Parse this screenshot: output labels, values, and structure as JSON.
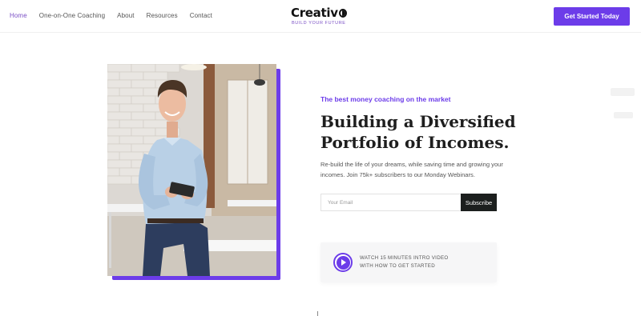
{
  "nav": {
    "items": [
      {
        "label": "Home",
        "active": true
      },
      {
        "label": "One-on-One Coaching",
        "active": false
      },
      {
        "label": "About",
        "active": false
      },
      {
        "label": "Resources",
        "active": false
      },
      {
        "label": "Contact",
        "active": false
      }
    ]
  },
  "logo": {
    "wordmark": "Creativ",
    "tagline": "BUILD YOUR FUTURE"
  },
  "header": {
    "cta_label": "Get Started Today"
  },
  "hero": {
    "eyebrow": "The best money coaching on the market",
    "headline_line1": "Building a Diversified",
    "headline_line2": "Portfolio of Incomes.",
    "subtext": "Re-build the life of your dreams, while saving time and growing your incomes. Join 75k+ subscribers to our Monday Webinars.",
    "email_placeholder": "Your Email",
    "subscribe_label": "Subscribe",
    "video_line1": "WATCH 15 MINUTES INTRO VIDEO",
    "video_line2": "WITH HOW TO GET STARTED"
  },
  "colors": {
    "accent": "#6c3ce9",
    "nav_active": "#7a4fc5",
    "dark_button": "#1c1f1e"
  },
  "icons": {
    "play": "play-icon",
    "logo_mark": "logo-mark-icon"
  }
}
